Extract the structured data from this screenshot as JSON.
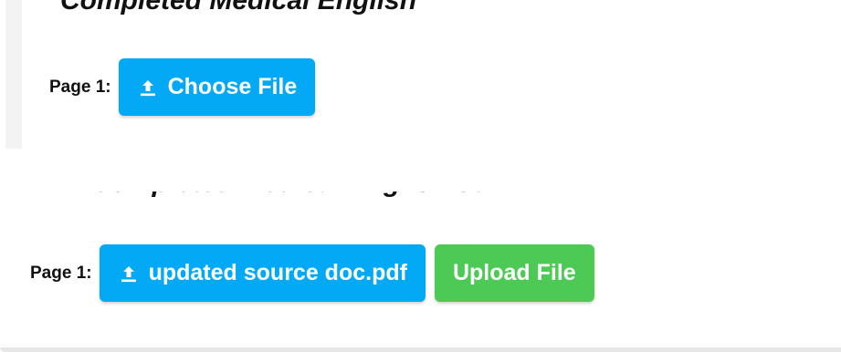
{
  "before": {
    "heading_fragment": "Completed Medical English",
    "page_label": "Page 1:",
    "choose_button": {
      "icon": "upload-icon",
      "label": "Choose File",
      "color": "#03a9f4"
    }
  },
  "after": {
    "heading_fragment": "Completed Medical English Survey",
    "page_label": "Page 1:",
    "file_button": {
      "icon": "upload-icon",
      "label": "updated source doc.pdf",
      "color": "#03a9f4"
    },
    "upload_button": {
      "label": "Upload File",
      "color": "#4cca55"
    }
  }
}
